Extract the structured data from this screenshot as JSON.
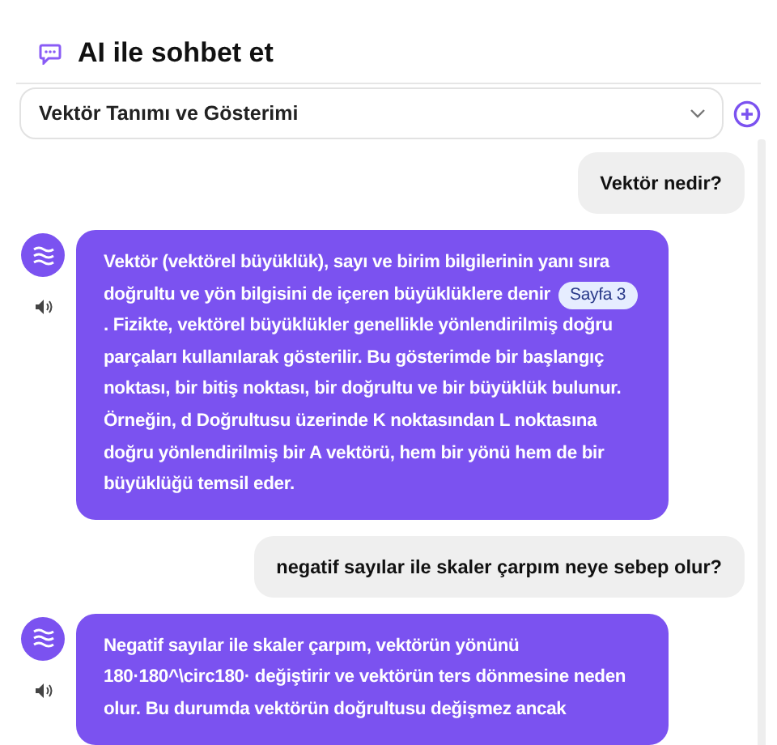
{
  "header": {
    "title": "AI ile sohbet et"
  },
  "topic_select": {
    "value": "Vektör Tanımı ve Gösterimi"
  },
  "messages": [
    {
      "kind": "user",
      "text": "Vektör nedir?"
    },
    {
      "kind": "bot",
      "parts": [
        {
          "kind": "text",
          "text": "Vektör (vektörel büyüklük), sayı ve birim bilgilerinin yanı sıra doğrultu ve yön bilgisini de içeren büyüklüklere denir"
        },
        {
          "kind": "source",
          "text": "Sayfa 3"
        },
        {
          "kind": "text",
          "text": ". Fizikte, vektörel büyüklükler genellikle yönlendirilmiş doğru parçaları kullanılarak gösterilir. Bu gösterimde bir başlangıç noktası, bir bitiş noktası, bir doğrultu ve bir büyüklük bulunur. Örneğin, d Doğrultusu üzerinde K noktasından L noktasına doğru yönlendirilmiş bir A vektörü, hem bir yönü hem de bir büyüklüğü temsil eder."
        }
      ]
    },
    {
      "kind": "user",
      "text": "negatif sayılar ile skaler çarpım neye sebep olur?"
    },
    {
      "kind": "bot",
      "parts": [
        {
          "kind": "text",
          "text": "Negatif sayılar ile skaler çarpım, vektörün yönünü 180·180^\\circ180· değiştirir ve vektörün ters dönmesine neden olur. Bu durumda vektörün doğrultusu değişmez ancak"
        }
      ]
    }
  ]
}
